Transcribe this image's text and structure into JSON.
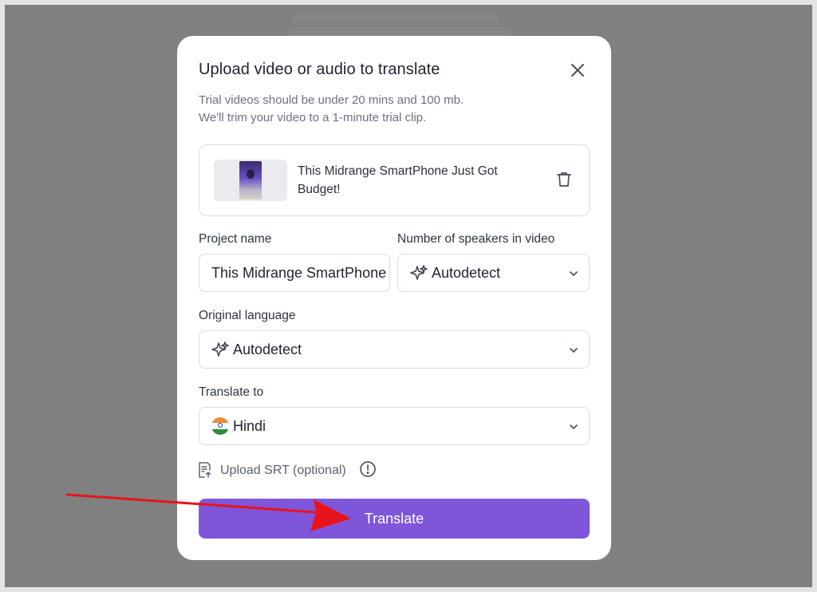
{
  "modal": {
    "title": "Upload video or audio to translate",
    "subtitle_line1": "Trial videos should be under 20 mins and 100 mb.",
    "subtitle_line2": "We'll trim your video to a 1-minute trial clip."
  },
  "file": {
    "name": "This Midrange SmartPhone Just Got Budget!"
  },
  "fields": {
    "project_name_label": "Project name",
    "project_name_value": "This Midrange SmartPhone Just Got Budget!",
    "speakers_label": "Number of speakers in video",
    "speakers_value": "Autodetect",
    "original_language_label": "Original language",
    "original_language_value": "Autodetect",
    "translate_to_label": "Translate to",
    "translate_to_value": "Hindi"
  },
  "srt": {
    "label": "Upload SRT (optional)"
  },
  "actions": {
    "translate_label": "Translate"
  },
  "icons": {
    "close": "close-icon",
    "trash": "trash-icon",
    "sparkle": "sparkle-icon",
    "chevron": "chevron-down-icon",
    "flag": "india-flag-icon",
    "srt": "document-upload-icon",
    "info": "info-icon"
  },
  "colors": {
    "accent": "#7f56d9",
    "annotation_arrow": "#e8141b",
    "backdrop": "#808080"
  }
}
